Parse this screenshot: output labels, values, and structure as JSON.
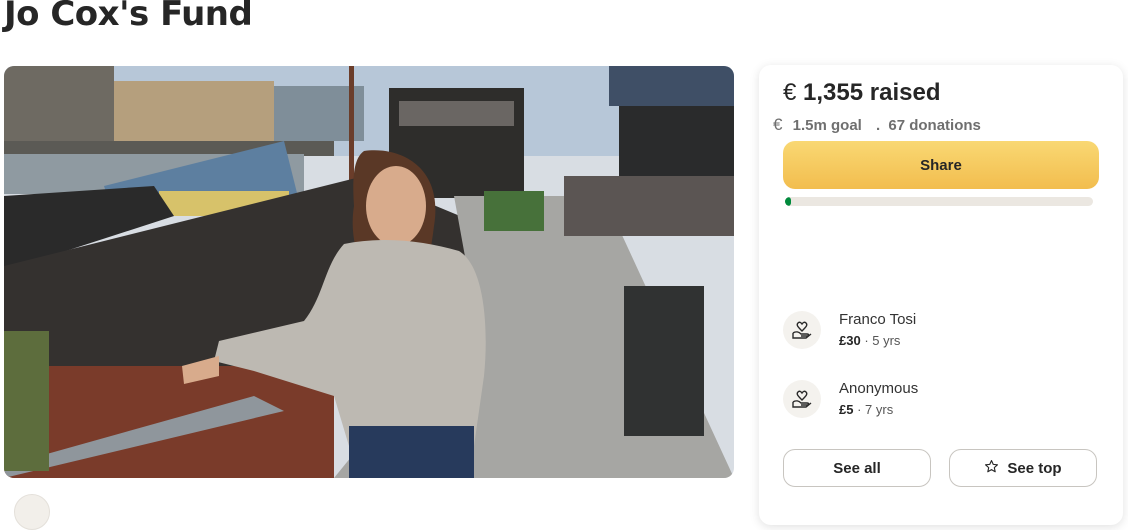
{
  "page": {
    "title": "Jo Cox's Fund"
  },
  "campaign": {
    "currency_symbol": "€",
    "raised_amount": "1,355",
    "raised_suffix": "raised",
    "goal": "1.5m goal",
    "donations": "67 donations",
    "progress_fraction": 0.02
  },
  "actions": {
    "share_label": "Share",
    "see_all_label": "See all",
    "see_top_label": "See top"
  },
  "donors": [
    {
      "name": "Franco Tosi",
      "amount": "£30",
      "time": "5 yrs",
      "icon": "heart-hand-icon"
    },
    {
      "name": "Anonymous",
      "amount": "£5",
      "time": "7 yrs",
      "icon": "heart-hand-icon"
    }
  ],
  "colors": {
    "accent": "#f2bd4e",
    "progress": "#008a3c"
  }
}
